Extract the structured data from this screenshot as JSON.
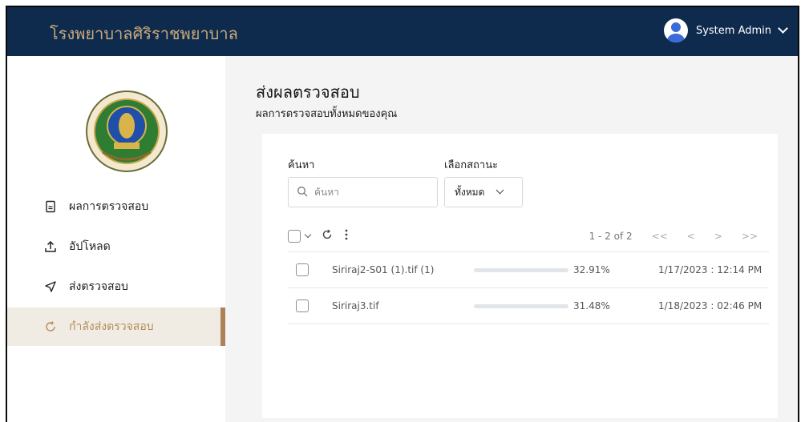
{
  "header": {
    "brand": "โรงพยาบาลศิริราชพยาบาล",
    "user_name": "System Admin",
    "user_icon": "avatar-icon"
  },
  "sidebar": {
    "logo_alt": "hospital-seal-logo",
    "items": [
      {
        "label": "ผลการตรวจสอบ",
        "icon": "document-icon",
        "active": false
      },
      {
        "label": "อัปโหลด",
        "icon": "upload-icon",
        "active": false
      },
      {
        "label": "ส่งตรวจสอบ",
        "icon": "send-icon",
        "active": false
      },
      {
        "label": "กำลังส่งตรวจสอบ",
        "icon": "refresh-icon",
        "active": true
      }
    ]
  },
  "main": {
    "title": "ส่งผลตรวจสอบ",
    "subtitle": "ผลการตรวจสอบทั้งหมดของคุณ",
    "search_label": "ค้นหา",
    "search_placeholder": "ค้นหา",
    "status_label": "เลือกสถานะ",
    "status_value": "ทั้งหมด",
    "pagination": {
      "range": "1 - 2 of 2",
      "first": "<<",
      "prev": "<",
      "next": ">",
      "last": ">>"
    },
    "rows": [
      {
        "filename": "Siriraj2-S01 (1).tif (1)",
        "progress": 32.91,
        "progress_text": "32.91%",
        "date": "1/17/2023 : 12:14 PM"
      },
      {
        "filename": "Siriraj3.tif",
        "progress": 31.48,
        "progress_text": "31.48%",
        "date": "1/18/2023 : 02:46 PM"
      }
    ]
  },
  "colors": {
    "topbar": "#0e2b4e",
    "brand_text": "#c9a97a",
    "active_accent": "#ac8356",
    "progress": "#2f6ee0"
  }
}
